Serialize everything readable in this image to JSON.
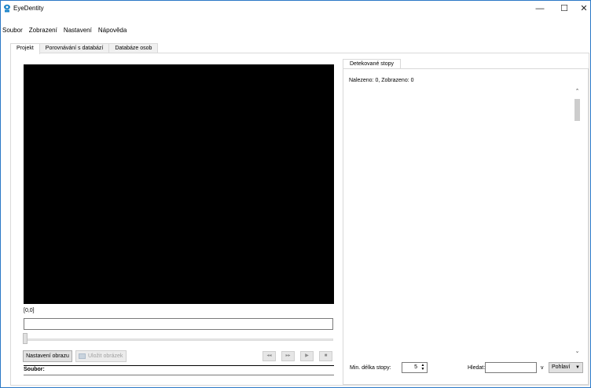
{
  "window": {
    "title": "EyeDentity",
    "controls": {
      "minimize": "—",
      "maximize": "☐",
      "close": "✕"
    }
  },
  "menu": [
    "Soubor",
    "Zobrazení",
    "Nastavení",
    "Nápověda"
  ],
  "tabs": [
    "Projekt",
    "Porovnávání s databází",
    "Databáze osob"
  ],
  "left_panel": {
    "coords": "[0,0]",
    "settings_button": "Nastavení obrazu",
    "save_button": "Uložit obrázek",
    "player_icons": {
      "rewind": "◂◂",
      "fast_forward": "▸▸",
      "play": "▶",
      "stop": "■"
    },
    "file_label": "Soubor:"
  },
  "right_panel": {
    "tab": "Detekované stopy",
    "found_text": "Nalezeno: 0, Zobrazeno: 0",
    "min_length_label": "Min. délka stopy:",
    "min_length_value": "5",
    "search_label": "Hledat:",
    "search_value": "",
    "in_label": "v",
    "filter_value": "Pohlaví"
  }
}
